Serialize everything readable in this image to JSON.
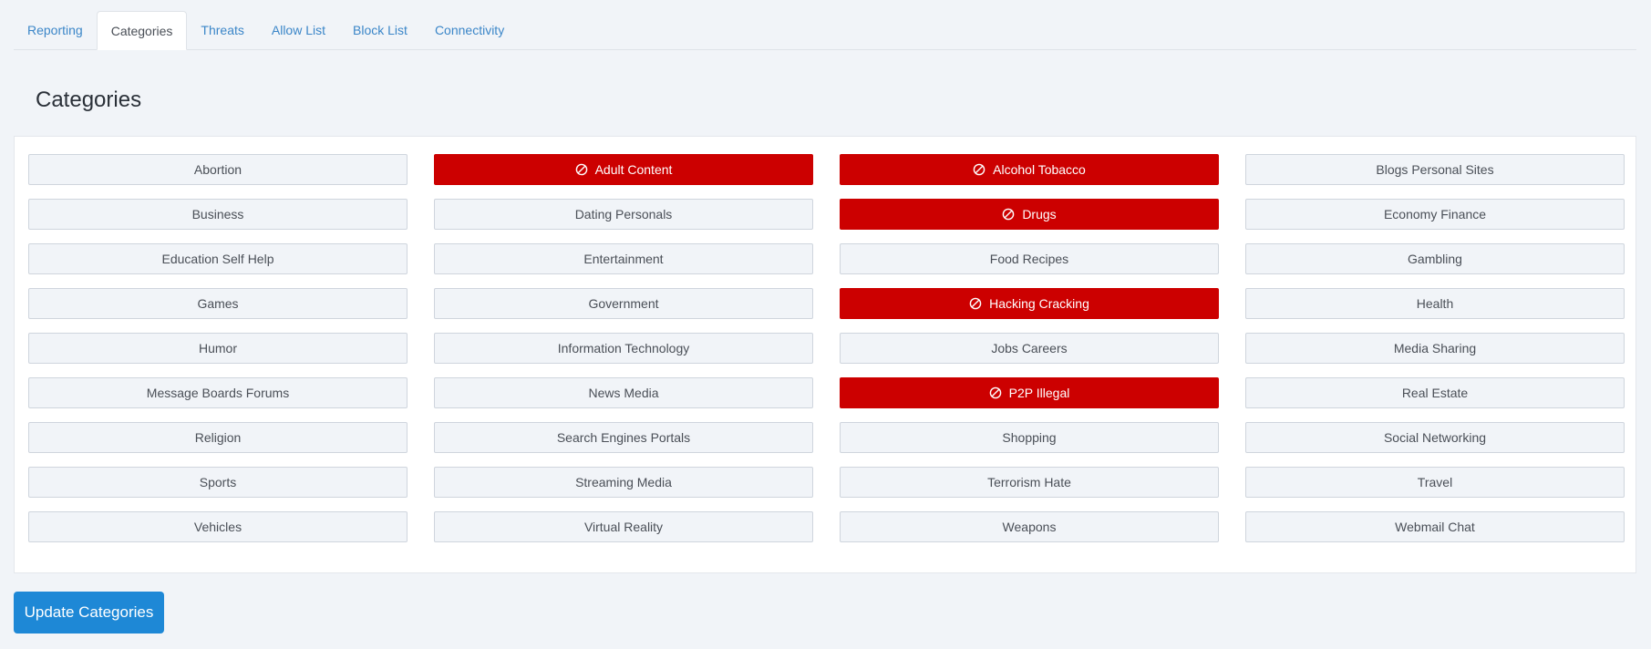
{
  "tabs": [
    {
      "label": "Reporting",
      "active": false
    },
    {
      "label": "Categories",
      "active": true
    },
    {
      "label": "Threats",
      "active": false
    },
    {
      "label": "Allow List",
      "active": false
    },
    {
      "label": "Block List",
      "active": false
    },
    {
      "label": "Connectivity",
      "active": false
    }
  ],
  "page": {
    "title": "Categories"
  },
  "colors": {
    "blocked": "#cc0000",
    "accent": "#1e88d6",
    "tab_link": "#3b86c8"
  },
  "categories": [
    {
      "label": "Abortion",
      "blocked": false
    },
    {
      "label": "Adult Content",
      "blocked": true
    },
    {
      "label": "Alcohol Tobacco",
      "blocked": true
    },
    {
      "label": "Blogs Personal Sites",
      "blocked": false
    },
    {
      "label": "Business",
      "blocked": false
    },
    {
      "label": "Dating Personals",
      "blocked": false
    },
    {
      "label": "Drugs",
      "blocked": true
    },
    {
      "label": "Economy Finance",
      "blocked": false
    },
    {
      "label": "Education Self Help",
      "blocked": false
    },
    {
      "label": "Entertainment",
      "blocked": false
    },
    {
      "label": "Food Recipes",
      "blocked": false
    },
    {
      "label": "Gambling",
      "blocked": false
    },
    {
      "label": "Games",
      "blocked": false
    },
    {
      "label": "Government",
      "blocked": false
    },
    {
      "label": "Hacking Cracking",
      "blocked": true
    },
    {
      "label": "Health",
      "blocked": false
    },
    {
      "label": "Humor",
      "blocked": false
    },
    {
      "label": "Information Technology",
      "blocked": false
    },
    {
      "label": "Jobs Careers",
      "blocked": false
    },
    {
      "label": "Media Sharing",
      "blocked": false
    },
    {
      "label": "Message Boards Forums",
      "blocked": false
    },
    {
      "label": "News Media",
      "blocked": false
    },
    {
      "label": "P2P Illegal",
      "blocked": true
    },
    {
      "label": "Real Estate",
      "blocked": false
    },
    {
      "label": "Religion",
      "blocked": false
    },
    {
      "label": "Search Engines Portals",
      "blocked": false
    },
    {
      "label": "Shopping",
      "blocked": false
    },
    {
      "label": "Social Networking",
      "blocked": false
    },
    {
      "label": "Sports",
      "blocked": false
    },
    {
      "label": "Streaming Media",
      "blocked": false
    },
    {
      "label": "Terrorism Hate",
      "blocked": false
    },
    {
      "label": "Travel",
      "blocked": false
    },
    {
      "label": "Vehicles",
      "blocked": false
    },
    {
      "label": "Virtual Reality",
      "blocked": false
    },
    {
      "label": "Weapons",
      "blocked": false
    },
    {
      "label": "Webmail Chat",
      "blocked": false
    }
  ],
  "blocked_icon": "block-icon",
  "actions": {
    "update_label": "Update Categories"
  }
}
